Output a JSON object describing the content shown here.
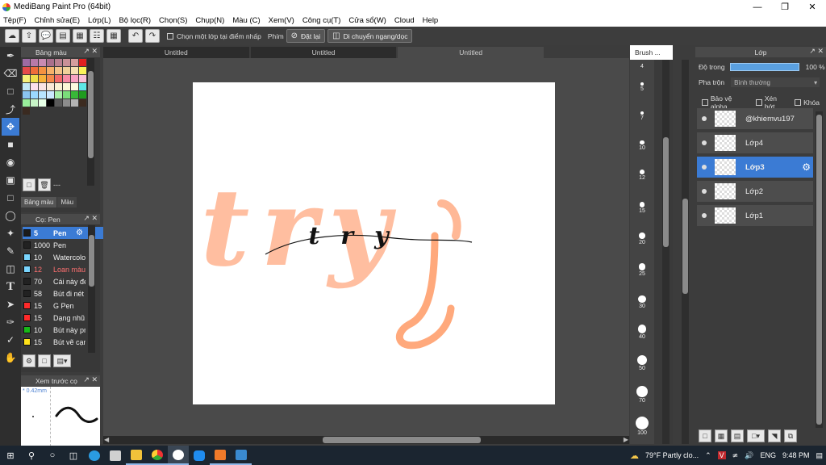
{
  "window": {
    "title": "MediBang Paint Pro (64bit)",
    "minimize": "—",
    "maximize": "❐",
    "close": "✕"
  },
  "menu": [
    "Tệp(F)",
    "Chỉnh sửa(E)",
    "Lớp(L)",
    "Bộ lọc(R)",
    "Chọn(S)",
    "Chụp(N)",
    "Màu (C)",
    "Xem(V)",
    "Công cụ(T)",
    "Cửa sổ(W)",
    "Cloud",
    "Help"
  ],
  "toolbar": {
    "select_one_layer": "Chọn một lớp tại điểm nhấp",
    "key_label": "Phím",
    "reset_label": "Đặt lại",
    "move_label": "Di chuyển ngang/dọc"
  },
  "palette_panel": {
    "title": "Bảng màu",
    "tab_palette": "Bảng màu",
    "tab_color": "Màu",
    "field_value": "---",
    "swatches": [
      "#9e6ba3",
      "#b77aa8",
      "#c98bb1",
      "#a96f8c",
      "#b98091",
      "#c99097",
      "#d59e9e",
      "#e02020",
      "#e64a4a",
      "#ef6d3a",
      "#f59241",
      "#f7b16a",
      "#f4c38a",
      "#f0d09a",
      "#f6e0b3",
      "#f9f35a",
      "#f6f07a",
      "#eedd4a",
      "#f7b23a",
      "#f58a4a",
      "#f36a6a",
      "#f78aa5",
      "#f8a2c3",
      "#f9c0d8",
      "#c2e8f5",
      "#fbe0ec",
      "#fae4e4",
      "#fae9d8",
      "#fbf2d5",
      "#fcf8d8",
      "#fbfbe0",
      "#5ee6e6",
      "#8ac4f0",
      "#9bd8ff",
      "#b8e4ff",
      "#cce8ff",
      "#a8f0a8",
      "#7ade7a",
      "#38b838",
      "#1e9c1e",
      "#9aee9a",
      "#c8f5c8",
      "#e6ffe6",
      "#000000",
      "#5a5a5a",
      "#8c8c8c",
      "#b4b4b4",
      "#3c2b20",
      "#3a2a20"
    ]
  },
  "brush_panel": {
    "title": "Cọ: Pen",
    "brushes": [
      {
        "size": "5",
        "name": "Pen",
        "color": "#1b1b1b",
        "selected": true
      },
      {
        "size": "1000",
        "name": "Pen",
        "color": "#222222"
      },
      {
        "size": "10",
        "name": "Watercolor",
        "color": "#7ad6ff"
      },
      {
        "size": "12",
        "name": "Loan màu",
        "color": "#7ad6ff",
        "red": true
      },
      {
        "size": "70",
        "name": "Cái này đẹp",
        "color": "#222222"
      },
      {
        "size": "58",
        "name": "Bút đi nét",
        "color": "#222222"
      },
      {
        "size": "15",
        "name": "G Pen",
        "color": "#ff2a2a"
      },
      {
        "size": "15",
        "name": "Dạng nhũ",
        "color": "#ff2a2a"
      },
      {
        "size": "10",
        "name": "Bút này pro",
        "color": "#18b818"
      },
      {
        "size": "15",
        "name": "Bút vẽ cạnh",
        "color": "#ffe21a"
      }
    ]
  },
  "preview_panel": {
    "title": "Xem trước cọ",
    "size": "0.42mm"
  },
  "documents": [
    {
      "name": "Untitled",
      "active": false
    },
    {
      "name": "Untitled",
      "active": false
    },
    {
      "name": "Untitled",
      "active": true
    }
  ],
  "artwork": {
    "big_text": "try",
    "script_text": "try",
    "fill_color": "#ffb896",
    "ink_color": "#111111"
  },
  "brush_sizes": {
    "title": "Brush ...",
    "items": [
      "4",
      "5",
      "7",
      "10",
      "12",
      "15",
      "20",
      "25",
      "30",
      "40",
      "50",
      "70",
      "100"
    ]
  },
  "layers_panel": {
    "title": "Lớp",
    "opacity_label": "Độ trong",
    "opacity_value": "100 %",
    "opacity": 1.0,
    "blend_label": "Pha trộn",
    "blend_value": "Bình thường",
    "protect_alpha": "Bảo vệ alpha",
    "clipping": "Xén bớt",
    "lock": "Khóa",
    "layers": [
      {
        "name": "@khiemvu197",
        "selected": false
      },
      {
        "name": "Lớp4",
        "selected": false
      },
      {
        "name": "Lớp3",
        "selected": true
      },
      {
        "name": "Lớp2",
        "selected": false
      },
      {
        "name": "Lớp1",
        "selected": false
      }
    ]
  },
  "taskbar": {
    "weather": "79°F  Partly clo...",
    "language": "ENG",
    "time": "9:48 PM"
  }
}
